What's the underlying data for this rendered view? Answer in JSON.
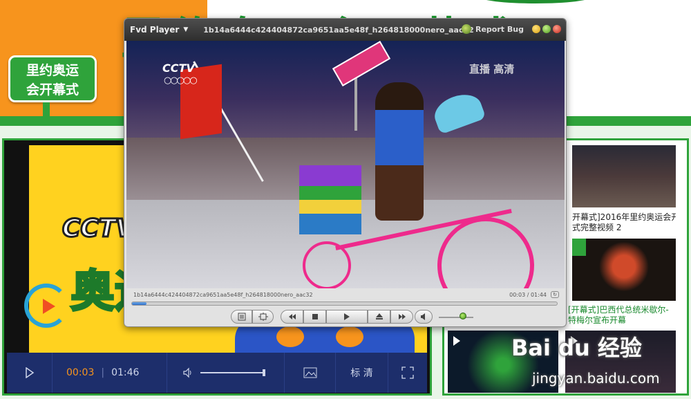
{
  "background_page": {
    "banner_title": "里约奥运会开幕式",
    "badge_line1": "里约奥运",
    "badge_line2": "会开幕式",
    "left_player": {
      "current_time": "00:03",
      "total_time": "01:46",
      "quality_label": "标 清",
      "cctv_logo": "CCTV",
      "ao_text": "奥运"
    },
    "videos": [
      {
        "caption_line1": "开幕式]2016年里约奥运会开",
        "caption_line2": "式完整视频 2"
      },
      {
        "caption_line1": "[开幕式]巴西代总统米歇尔-",
        "caption_line2": "特梅尔宣布开幕"
      }
    ]
  },
  "watermark": {
    "main": "Bai du 经验",
    "sub": "jingyan.baidu.com"
  },
  "player": {
    "app_name": "Fvd Player",
    "window_title": "1b14a6444c424404872ca9651aa5e48f_h264818000nero_aac32",
    "report_bug": "Report Bug",
    "filename": "1b14a6444c424404872ca9651aa5e48f_h264818000nero_aac32",
    "time_display": "00:03 / 01:44",
    "progress_fraction": 0.034,
    "volume_fraction": 0.7,
    "overlay_logo": "CCTV",
    "overlay_rings": "○○○○○",
    "overlay_live": "直播 高清",
    "colors": {
      "accent_blue": "#2e6fc8",
      "close": "#e0443a",
      "maximize": "#8bc34a",
      "minimize": "#f2c230"
    },
    "controls": {
      "playlist_icon": "playlist-icon",
      "fullscreen_icon": "fit-screen-icon",
      "rewind_icon": "rewind-icon",
      "stop_icon": "stop-icon",
      "play_icon": "play-icon",
      "eject_icon": "eject-icon",
      "forward_icon": "fast-forward-icon",
      "mute_icon": "speaker-icon"
    }
  }
}
